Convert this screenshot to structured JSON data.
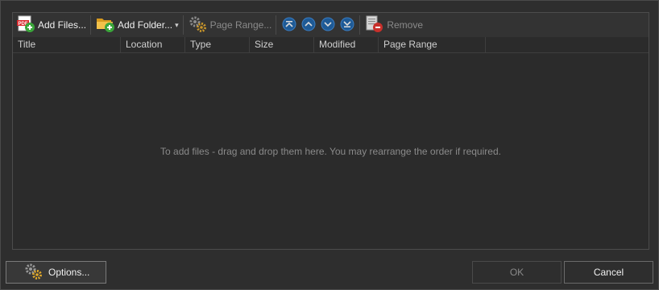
{
  "toolbar": {
    "add_files_label": "Add Files...",
    "add_folder_label": "Add Folder...",
    "page_range_label": "Page Range...",
    "remove_label": "Remove"
  },
  "columns": [
    "Title",
    "Location",
    "Type",
    "Size",
    "Modified",
    "Page Range"
  ],
  "empty_message": "To add files - drag and drop them here. You may rearrange the order if required.",
  "buttons": {
    "options_label": "Options...",
    "ok_label": "OK",
    "cancel_label": "Cancel"
  },
  "colors": {
    "background": "#2b2b2b",
    "accent_blue": "#1e78c8",
    "pdf_red": "#d9262b",
    "add_green": "#3aa63a",
    "folder_yellow": "#e8b530",
    "remove_red": "#c8302b"
  },
  "icons": {
    "add_files": "pdf-add-icon",
    "add_folder": "folder-add-icon",
    "page_range": "gears-icon",
    "move_top": "move-to-top-icon",
    "move_up": "move-up-icon",
    "move_down": "move-down-icon",
    "move_bottom": "move-to-bottom-icon",
    "remove": "remove-document-icon",
    "options": "gears-icon"
  }
}
